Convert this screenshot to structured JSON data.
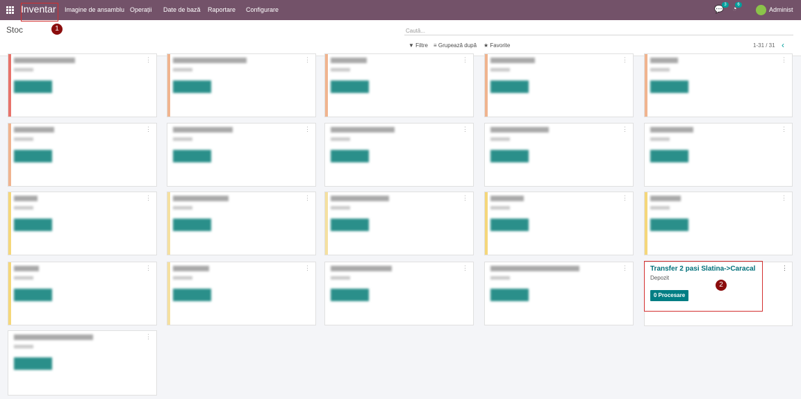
{
  "app": {
    "brand": "Inventar"
  },
  "menu": [
    "Imagine de ansamblu",
    "Operații",
    "Date de bază",
    "Raportare",
    "Configurare"
  ],
  "systray": {
    "messages_count": "3",
    "activities_count": "6",
    "user": "Administ"
  },
  "page": {
    "title": "Stoc"
  },
  "search": {
    "placeholder": "Caută..."
  },
  "filters": {
    "filter_label": "Filtre",
    "groupby_label": "Grupează după",
    "favorites_label": "Favorite"
  },
  "pager": {
    "value": "1-31 / 31"
  },
  "featured_card": {
    "title": "Transfer 2 pasi Slatina->Caracal",
    "subtitle": "Depozit",
    "button_label": "0 Procesare"
  },
  "annotations": {
    "marker1": "1",
    "marker2": "2"
  },
  "colors": {
    "topbar": "#735269",
    "accent": "#017e84",
    "annotation": "#d32f2f"
  }
}
